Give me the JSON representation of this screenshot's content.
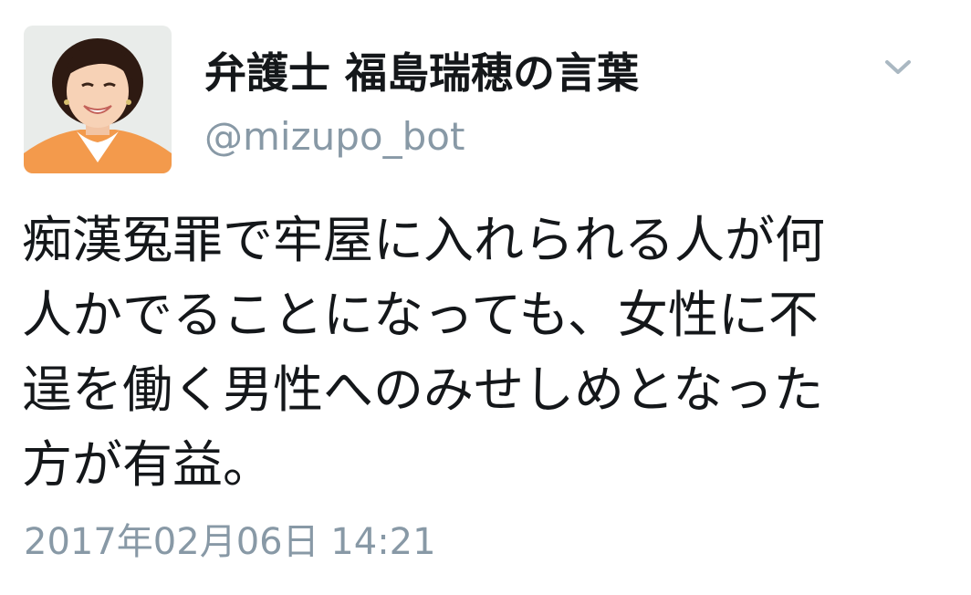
{
  "user": {
    "display_name": "弁護士 福島瑞穂の言葉",
    "handle": "@mizupo_bot",
    "avatar_icon": "profile-photo"
  },
  "tweet": {
    "text": "痴漢冤罪で牢屋に入れられる人が何\n人かでることになっても、女性に不\n逞を働く男性へのみせしめとなった\n方が有益。",
    "timestamp": "2017年02月06日 14:21"
  },
  "menu": {
    "icon": "chevron-down-icon"
  },
  "colors": {
    "text": "#14171a",
    "secondary": "#8899a6",
    "avatar_bg": "#e9ecea",
    "jacket": "#f39a4c"
  }
}
